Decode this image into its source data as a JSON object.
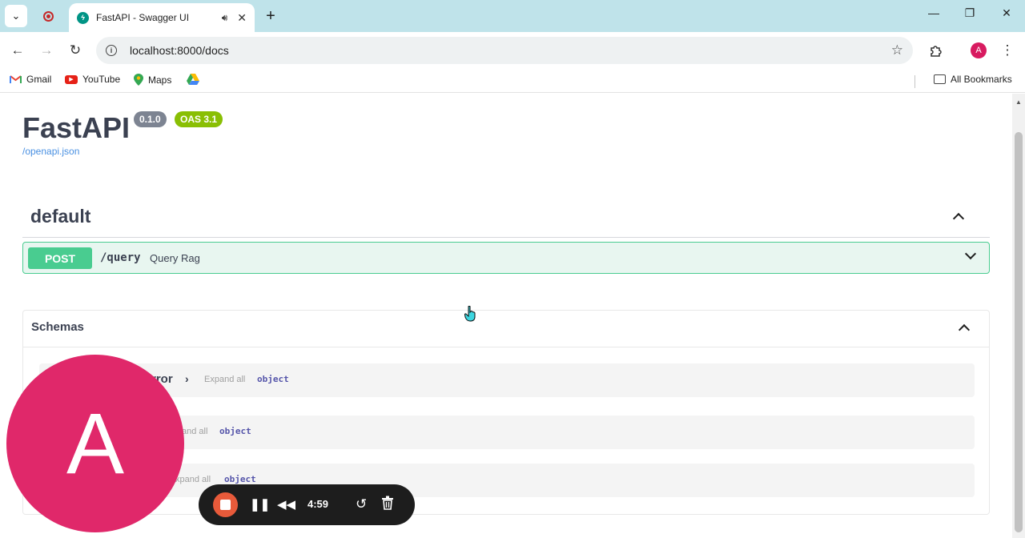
{
  "browser": {
    "tab_title": "FastAPI - Swagger UI",
    "url": "localhost:8000/docs",
    "new_tab_symbol": "+",
    "window_controls": {
      "minimize": "—",
      "restore": "❐",
      "close": "✕"
    },
    "bookmarks": [
      "Gmail",
      "YouTube",
      "Maps"
    ],
    "all_bookmarks_label": "All Bookmarks",
    "profile_initial": "A"
  },
  "api": {
    "title": "FastAPI",
    "version": "0.1.0",
    "oas_version": "OAS 3.1",
    "spec_link": "/openapi.json"
  },
  "tag": {
    "name": "default"
  },
  "operation": {
    "method": "POST",
    "path": "/query",
    "summary": "Query Rag"
  },
  "schemas": {
    "title": "Schemas",
    "models": [
      {
        "name": "rror",
        "expand_label": "Expand all",
        "type": "object"
      },
      {
        "name": "",
        "expand_label": "and all",
        "type": "object"
      },
      {
        "name": "",
        "expand_label": "xpand all",
        "type": "object"
      }
    ]
  },
  "recorder": {
    "avatar_initial": "A",
    "time": "4:59"
  },
  "colors": {
    "post_accent": "#49cc90",
    "oas_badge": "#89bf04",
    "version_badge": "#7d8492",
    "avatar": "#e0286a",
    "tabbar": "#bfe3ea"
  }
}
